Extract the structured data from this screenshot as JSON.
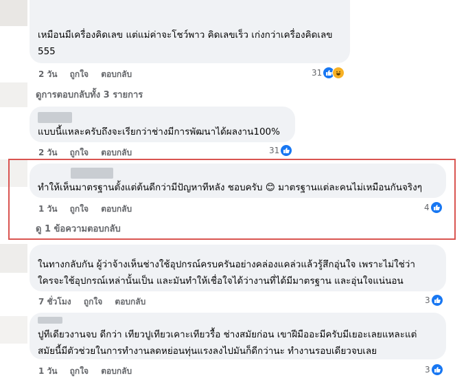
{
  "colors": {
    "highlight_border": "#d9534f",
    "like_blue": "#1877f2",
    "bubble_bg": "#f0f2f5"
  },
  "comments": [
    {
      "text_lines": [
        "เหมือนมีเครื่องคิดเลข แต่แม่ค่าจะโชว์พาว คิดเลขเร็ว เก่งกว่าเครื่องคิดเลข",
        "555"
      ],
      "time": "2 วัน",
      "like": "ถูกใจ",
      "reply": "ตอบกลับ",
      "reaction_count": "31",
      "reactions": [
        "like-icon",
        "haha-icon"
      ]
    },
    {
      "text_lines": [
        "แบบนี้แหละครับถึงจะเรียกว่าช่างมีการพัฒนาได้ผลงาน100%"
      ],
      "time": "2 วัน",
      "like": "ถูกใจ",
      "reply": "ตอบกลับ",
      "reaction_count": "31",
      "reactions": [
        "like-icon"
      ]
    },
    {
      "text_lines": [
        "ทำให้เห็นมาตรฐานตั้งแต่ต้นดีกว่ามีปัญหาทีหลัง ชอบครับ 😊 มาตรฐานแต่ละคนไม่เหมือนกันจริงๆ"
      ],
      "time": "1 วัน",
      "like": "ถูกใจ",
      "reply": "ตอบกลับ",
      "reaction_count": "4",
      "reactions": [
        "like-icon"
      ]
    },
    {
      "text_lines": [
        "ในทางกลับกัน ผู้ว่าจ้างเห็นช่างใช้อุปกรณ์ครบครันอย่างคล่องแคล่วแล้วรู้สึกอุ่นใจ เพราะไม่ใช่ว่า",
        "ใครจะใช้อุปกรณ์เหล่านั้นเป็น และมันทำให้เชื่อใจได้ว่างานที่ได้มีมาตรฐาน และอุ่นใจแน่นอน"
      ],
      "time": "7 ชั่วโมง",
      "like": "ถูกใจ",
      "reply": "ตอบกลับ",
      "reaction_count": "3",
      "reactions": [
        "like-icon"
      ]
    },
    {
      "text_lines": [
        "ปูทีเดียวงานจบ ดีกว่า เทียวปูเทียวเคาะเทียวรื้อ ช่างสมัยก่อน เขาฝีมืออะมีครับมีเยอะเลยแหละแต่",
        "สมัยนี้มีตัวช่วยในการทำงานลดหย่อนทุ่นแรงลงไปมันก็ดีกว่านะ ทำงานรอบเดียวจบเลย"
      ],
      "time": "1 วัน",
      "like": "ถูกใจ",
      "reply": "ตอบกลับ",
      "reaction_count": "3",
      "reactions": [
        "like-icon"
      ]
    }
  ],
  "view_replies": [
    "ดูการตอบกลับทั้ง 3 รายการ",
    "ดู 1 ข้อความตอบกลับ"
  ]
}
